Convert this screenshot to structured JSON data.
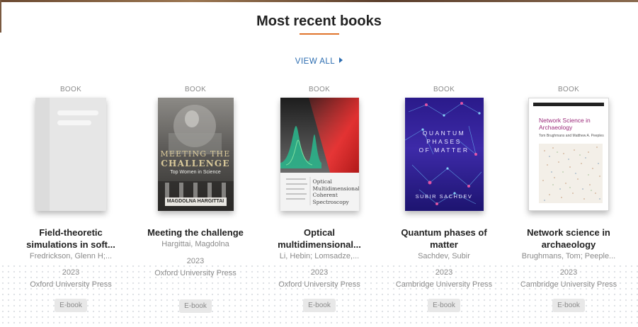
{
  "section": {
    "title": "Most recent books",
    "view_all": "VIEW ALL",
    "accent": "#e0742c",
    "link_color": "#2b6cb0"
  },
  "books": [
    {
      "type": "BOOK",
      "title_line1": "Field-theoretic",
      "title_line2": "simulations in soft...",
      "authors": "Fredrickson, Glenn H;...",
      "year": "2023",
      "publisher": "Oxford University Press",
      "format": "E-book",
      "cover": "placeholder"
    },
    {
      "type": "BOOK",
      "title_line1": "Meeting the challenge",
      "title_line2": "",
      "authors": "Hargittai, Magdolna",
      "year": "2023",
      "publisher": "Oxford University Press",
      "format": "E-book",
      "cover_text": {
        "title1": "MEETING THE",
        "title2": "CHALLENGE",
        "subtitle": "Top Women in Science",
        "author": "MAGDOLNA HARGITTAI"
      }
    },
    {
      "type": "BOOK",
      "title_line1": "Optical",
      "title_line2": "multidimensional...",
      "authors": "Li, Hebin; Lomsadze,...",
      "year": "2023",
      "publisher": "Oxford University Press",
      "format": "E-book",
      "cover_text": {
        "l1": "Optical",
        "l2": "Multidimensional",
        "l3": "Coherent",
        "l4": "Spectroscopy"
      }
    },
    {
      "type": "BOOK",
      "title_line1": "Quantum phases of",
      "title_line2": "matter",
      "authors": "Sachdev, Subir",
      "year": "2023",
      "publisher": "Cambridge University Press",
      "format": "E-book",
      "cover_text": {
        "l1": "QUANTUM",
        "l2": "PHASES",
        "l3": "OF MATTER",
        "author": "SUBIR SACHDEV"
      }
    },
    {
      "type": "BOOK",
      "title_line1": "Network science in",
      "title_line2": "archaeology",
      "authors": "Brughmans, Tom; Peeple...",
      "year": "2023",
      "publisher": "Cambridge University Press",
      "format": "E-book",
      "cover_text": {
        "title1": "Network Science in",
        "title2": "Archaeology",
        "authors": "Tom Brughmans and Matthew A. Peeples"
      }
    }
  ]
}
